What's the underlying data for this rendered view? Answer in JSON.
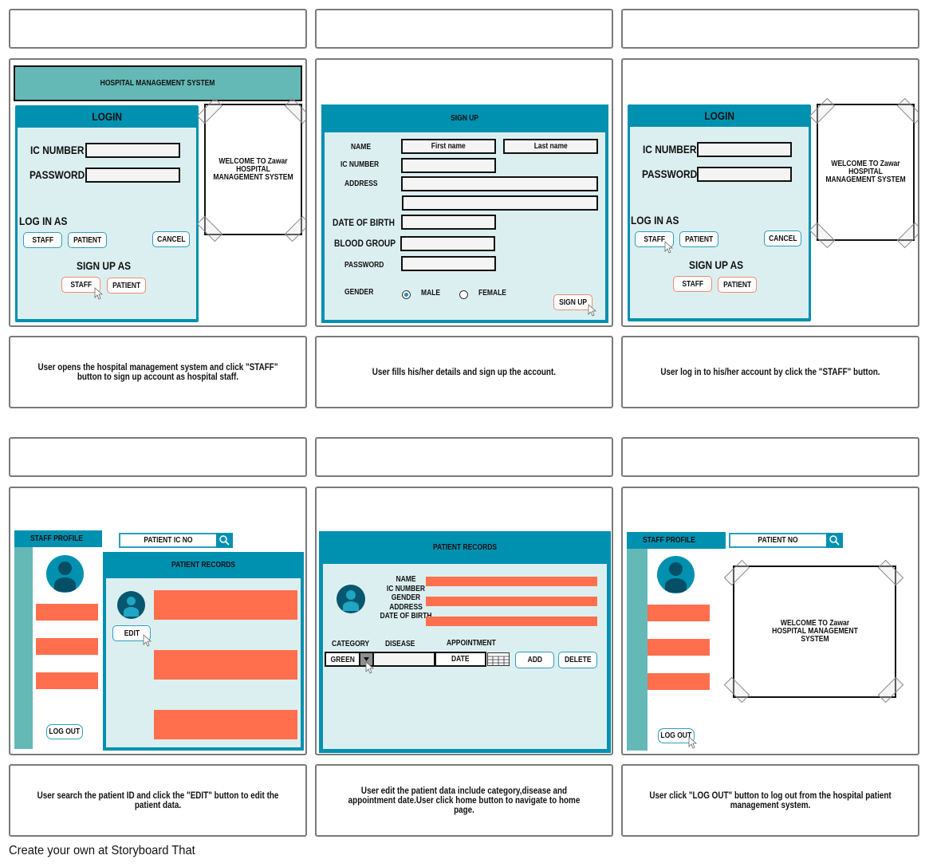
{
  "panels": [
    {
      "header": {
        "title": "HOSPITAL MANAGEMENT SYSTEM"
      },
      "login": {
        "title": "LOGIN",
        "ic_label": "IC NUMBER",
        "password_label": "PASSWORD",
        "login_as_label": "LOG IN AS",
        "login_staff": "STAFF",
        "login_patient": "PATIENT",
        "cancel": "CANCEL",
        "signup_as_label": "SIGN UP AS",
        "signup_staff": "STAFF",
        "signup_patient": "PATIENT"
      },
      "welcome": "WELCOME TO Zawar HOSPITAL MANAGEMENT SYSTEM",
      "description": "User opens the hospital management system and click \"STAFF\" button to sign up account as hospital staff."
    },
    {
      "signup": {
        "title": "SIGN UP",
        "name_label": "NAME",
        "first_name_placeholder": "First name",
        "last_name_placeholder": "Last name",
        "ic_label": "IC NUMBER",
        "address_label": "ADDRESS",
        "dob_label": "DATE OF BIRTH",
        "blood_label": "BLOOD GROUP",
        "password_label": "PASSWORD",
        "gender_label": "GENDER",
        "male": "MALE",
        "female": "FEMALE",
        "selected_gender": "MALE",
        "submit": "SIGN UP"
      },
      "description": "User fills his/her details and sign up the account."
    },
    {
      "login": {
        "title": "LOGIN",
        "ic_label": "IC NUMBER",
        "password_label": "PASSWORD",
        "login_as_label": "LOG IN AS",
        "login_staff": "STAFF",
        "login_patient": "PATIENT",
        "cancel": "CANCEL",
        "signup_as_label": "SIGN UP AS",
        "signup_staff": "STAFF",
        "signup_patient": "PATIENT"
      },
      "welcome": "WELCOME TO Zawar HOSPITAL MANAGEMENT SYSTEM",
      "description": "User log in to his/her account by click the \"STAFF\" button."
    },
    {
      "staff_profile": {
        "title": "STAFF PROFILE",
        "logout": "LOG OUT"
      },
      "search": {
        "placeholder": "PATIENT IC NO"
      },
      "records": {
        "title": "PATIENT RECORDS",
        "edit": "EDIT"
      },
      "description": "User search the patient ID and click the \"EDIT\" button to edit the patient data."
    },
    {
      "records": {
        "title": "PATIENT RECORDS",
        "fields": [
          "NAME",
          "IC NUMBER",
          "GENDER",
          "ADDRESS",
          "DATE OF BIRTH"
        ],
        "category_label": "CATEGORY",
        "disease_label": "DISEASE",
        "appointment_label": "APPOINTMENT",
        "category_value": "GREEN",
        "date_placeholder": "DATE",
        "add": "ADD",
        "delete": "DELETE"
      },
      "description": "User edit the patient data include category,disease and appointment date.User click home button to navigate to home page."
    },
    {
      "staff_profile": {
        "title": "STAFF PROFILE",
        "logout": "LOG OUT"
      },
      "search": {
        "placeholder": "PATIENT NO"
      },
      "welcome": "WELCOME TO Zawar HOSPITAL MANAGEMENT SYSTEM",
      "description": "User click \"LOG OUT\" button to log out from the hospital patient management system."
    }
  ],
  "footer": "Create your own at Storyboard That",
  "colors": {
    "teal_header": "#0090b0",
    "light_teal": "#64b9b6",
    "pale_panel": "#dceff0",
    "orange_field": "#ff6f4e",
    "button_blue_border": "#2a9fc0",
    "button_red_border": "#f08a70"
  }
}
